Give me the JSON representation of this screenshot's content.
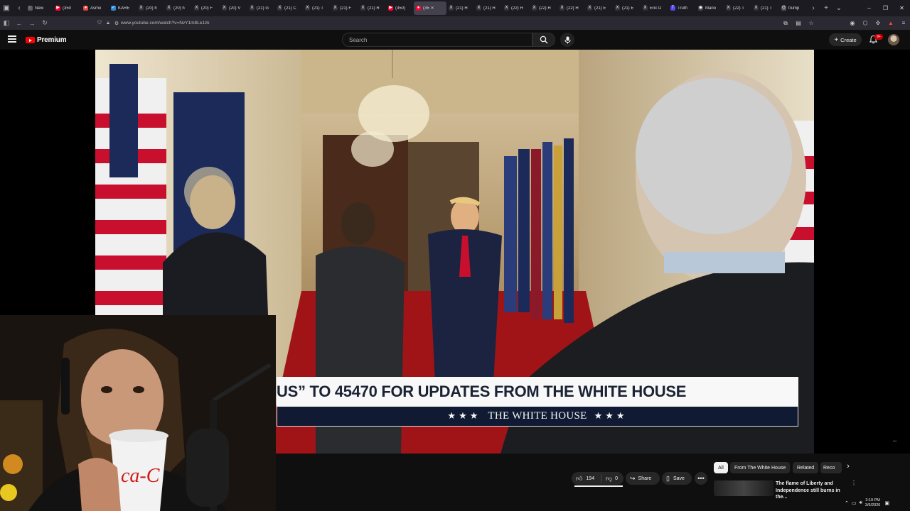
{
  "browser": {
    "tabs": [
      {
        "label": "New",
        "color": "#5a5a66",
        "glyph": "◌"
      },
      {
        "label": "(350",
        "color": "#ff0033",
        "glyph": "▶"
      },
      {
        "label": "Asmo",
        "color": "#e6443a",
        "glyph": "●"
      },
      {
        "label": "KARE",
        "color": "#2c8cd6",
        "glyph": "✓"
      },
      {
        "label": "(20) h",
        "color": "#333",
        "glyph": "X"
      },
      {
        "label": "(20) h",
        "color": "#333",
        "glyph": "X"
      },
      {
        "label": "(20) F",
        "color": "#333",
        "glyph": "X"
      },
      {
        "label": "(20) V",
        "color": "#333",
        "glyph": "X"
      },
      {
        "label": "(21) G",
        "color": "#333",
        "glyph": "X"
      },
      {
        "label": "(21) C",
        "color": "#333",
        "glyph": "X"
      },
      {
        "label": "(21) T",
        "color": "#333",
        "glyph": "X"
      },
      {
        "label": "(21) F",
        "color": "#333",
        "glyph": "X"
      },
      {
        "label": "(21) R",
        "color": "#333",
        "glyph": "X"
      },
      {
        "label": "(350)",
        "color": "#ff0033",
        "glyph": "▶"
      },
      {
        "label": "(35",
        "color": "#ff0033",
        "glyph": "●",
        "active": true
      },
      {
        "label": "(21) H",
        "color": "#333",
        "glyph": "X"
      },
      {
        "label": "(21) H",
        "color": "#333",
        "glyph": "X"
      },
      {
        "label": "(22) H",
        "color": "#333",
        "glyph": "X"
      },
      {
        "label": "(22) H",
        "color": "#333",
        "glyph": "X"
      },
      {
        "label": "(22) H",
        "color": "#333",
        "glyph": "X"
      },
      {
        "label": "(21) E",
        "color": "#333",
        "glyph": "X"
      },
      {
        "label": "(21) E",
        "color": "#333",
        "glyph": "X"
      },
      {
        "label": "Eric D",
        "color": "#333",
        "glyph": "X"
      },
      {
        "label": "Truth",
        "color": "#5448ee",
        "glyph": "T"
      },
      {
        "label": "Mario",
        "color": "#444",
        "glyph": "◉"
      },
      {
        "label": "(22) T",
        "color": "#333",
        "glyph": "X"
      },
      {
        "label": "(21) T",
        "color": "#333",
        "glyph": "X"
      },
      {
        "label": "trump",
        "color": "#555",
        "glyph": "G"
      }
    ],
    "url": "www.youtube.com/watch?v=NvY1m8Le1zk"
  },
  "youtube": {
    "logo_text": "Premium",
    "search_placeholder": "Search",
    "create_label": "Create",
    "notification_count": "9+",
    "brand_color": "#ff0000"
  },
  "video": {
    "banner_text": "US” TO 45470 FOR UPDATES FROM THE WHITE HOUSE",
    "banner_sub": "THE WHITE HOUSE",
    "stars": "★★★",
    "banner_navy": "#101a33"
  },
  "actions": {
    "likes": "194",
    "dislikes": "0",
    "share_label": "Share",
    "save_label": "Save"
  },
  "chips": [
    "All",
    "From The White House",
    "Related",
    "Reco"
  ],
  "recommendation": {
    "title": "The flame of Liberty and Independence still burns in the..."
  },
  "taskbar": {
    "time": "3:19 PM",
    "date": "3/6/2026"
  }
}
